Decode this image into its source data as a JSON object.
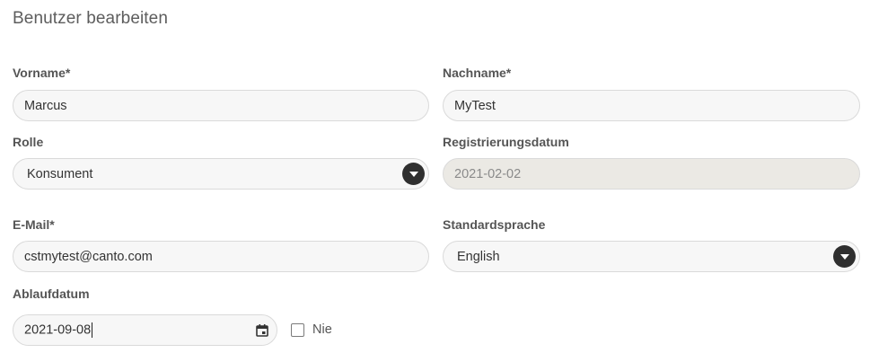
{
  "page": {
    "title": "Benutzer bearbeiten"
  },
  "form": {
    "vorname": {
      "label": "Vorname*",
      "value": "Marcus"
    },
    "nachname": {
      "label": "Nachname*",
      "value": "MyTest"
    },
    "rolle": {
      "label": "Rolle",
      "value": "Konsument"
    },
    "registrierungsdatum": {
      "label": "Registrierungsdatum",
      "value": "2021-02-02"
    },
    "email": {
      "label": "E-Mail*",
      "value": "cstmytest@canto.com"
    },
    "standardsprache": {
      "label": "Standardsprache",
      "value": "English"
    },
    "ablaufdatum": {
      "label": "Ablaufdatum",
      "value": "2021-09-08"
    },
    "nie": {
      "label": "Nie",
      "checked": false
    }
  },
  "icons": {
    "dropdown": "chevron-down-icon",
    "calendar": "calendar-icon"
  },
  "colors": {
    "field_bg": "#f7f7f7",
    "field_border": "#dadada",
    "disabled_bg": "#ebe9e4",
    "dropdown_button": "#2f2f2f"
  }
}
